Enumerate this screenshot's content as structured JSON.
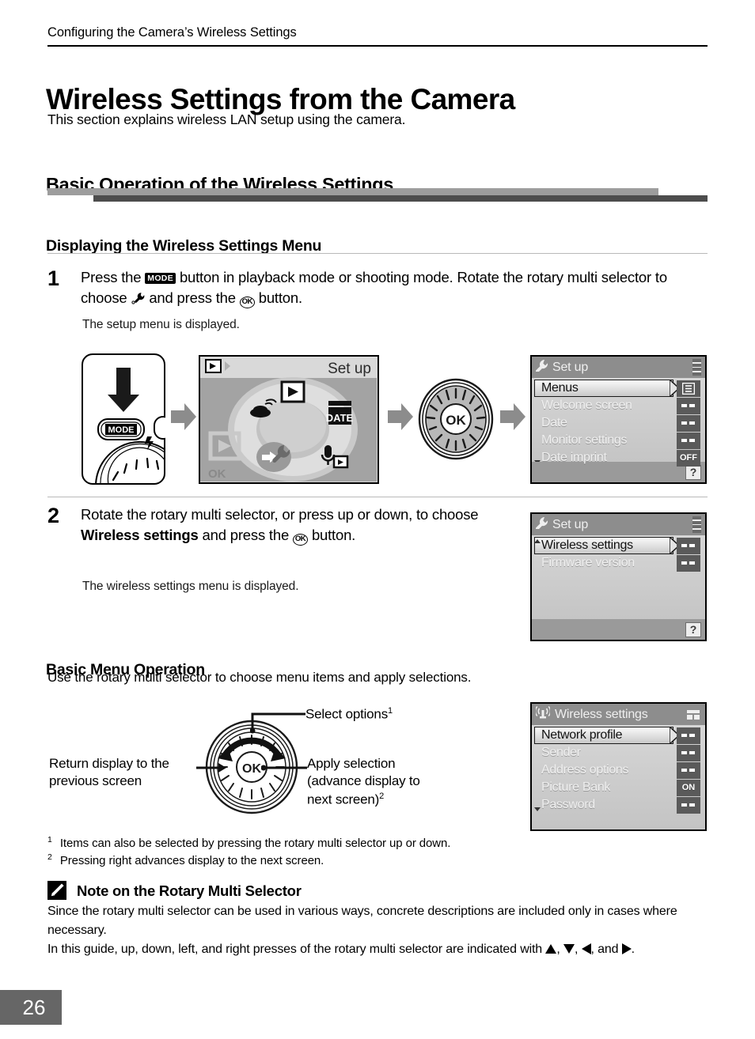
{
  "running_head": "Configuring the Camera’s Wireless Settings",
  "page_number": "26",
  "title": "Wireless Settings from the Camera",
  "title_sub": "This section explains wireless LAN setup using the camera.",
  "section": {
    "h2": "Basic Operation of the Wireless Settings",
    "h3_displaying": "Displaying the Wireless Settings Menu",
    "h3_basic_menu": "Basic Menu Operation",
    "basic_menu_intro": "Use the rotary multi selector to choose menu items and apply selections."
  },
  "steps": [
    {
      "number": "1",
      "text_part1": "Press the ",
      "mode_label": "MODE",
      "text_part2": " button in playback mode or shooting mode. Rotate the rotary multi selector to choose ",
      "text_part3": " and press the ",
      "ok_label": "OK",
      "text_part4": " button.",
      "note": "The setup menu is displayed."
    },
    {
      "number": "2",
      "text_part1": "Rotate the rotary multi selector, or press up or down, to choose ",
      "bold_target": "Wireless settings",
      "text_part2": " and press the ",
      "ok_label": "OK",
      "text_part3": " button.",
      "note": "The wireless settings menu is displayed."
    }
  ],
  "camera_illustration": {
    "mode_button_label": "MODE",
    "dial_screen": {
      "mode_title": "Set up",
      "ok_hint": "OK",
      "icons": [
        "playback-icon",
        "date-icon",
        "transfer-icon",
        "wrench-icon",
        "voice-record-icon"
      ]
    },
    "rotary_selector_label": "OK"
  },
  "screens": {
    "setup_1": {
      "title": "Set up",
      "title_icon": "wrench-icon",
      "items": [
        {
          "label": "Menus",
          "badge": "menu-list-icon",
          "selected": true
        },
        {
          "label": "Welcome screen",
          "badge": "--",
          "selected": false
        },
        {
          "label": "Date",
          "badge": "--",
          "selected": false
        },
        {
          "label": "Monitor settings",
          "badge": "--",
          "selected": false
        },
        {
          "label": "Date imprint",
          "badge": "OFF",
          "selected": false
        }
      ],
      "help_badge": "?"
    },
    "setup_2": {
      "title": "Set up",
      "title_icon": "wrench-icon",
      "items": [
        {
          "label": "Wireless settings",
          "badge": "--",
          "selected": true
        },
        {
          "label": "Firmware version",
          "badge": "--",
          "selected": false
        }
      ],
      "help_badge": "?"
    },
    "wireless": {
      "title": "Wireless settings",
      "title_icon": "antenna-icon",
      "items": [
        {
          "label": "Network profile",
          "badge": "--",
          "selected": true
        },
        {
          "label": "Sender",
          "badge": "--",
          "selected": false
        },
        {
          "label": "Address options",
          "badge": "--",
          "selected": false
        },
        {
          "label": "Picture Bank",
          "badge": "ON",
          "selected": false
        },
        {
          "label": "Password",
          "badge": "--",
          "selected": false
        }
      ]
    }
  },
  "diagram": {
    "top_callout": "Select options",
    "top_callout_sup": "1",
    "left_callout_line1": "Return display to the",
    "left_callout_line2": "previous screen",
    "right_callout_line1": "Apply selection",
    "right_callout_line2": "(advance display to",
    "right_callout_line3": "next screen)",
    "right_callout_sup": "2",
    "center_label": "OK"
  },
  "footnotes": [
    {
      "marker": "1",
      "text": "Items can also be selected by pressing the rotary multi selector up or down."
    },
    {
      "marker": "2",
      "text": "Pressing right advances display to the next screen."
    }
  ],
  "note": {
    "icon": "pencil-icon",
    "heading": "Note on the Rotary Multi Selector",
    "para1": "Since the rotary multi selector can be used in various ways, concrete descriptions are included only in cases where necessary.",
    "para2_a": "In this guide, up, down, left, and right presses of the rotary multi selector are indicated with ",
    "para2_b": ", ",
    "para2_c": ", ",
    "para2_d": ", and ",
    "para2_e": "."
  },
  "colors": {
    "bar_light": "#9d9d9d",
    "bar_dark": "#4d4d4d",
    "page_num_bg": "#666666",
    "lcd_bg": "#c9c9c9"
  }
}
